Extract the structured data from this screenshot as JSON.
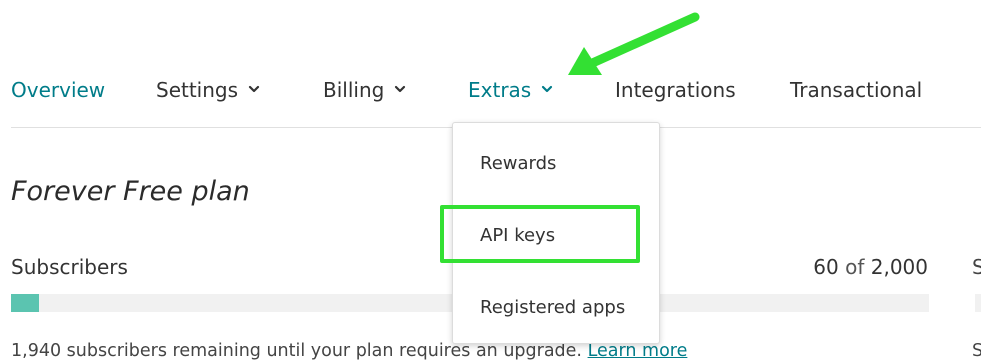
{
  "nav": {
    "items": [
      {
        "label": "Overview"
      },
      {
        "label": "Settings"
      },
      {
        "label": "Billing"
      },
      {
        "label": "Extras"
      },
      {
        "label": "Integrations"
      },
      {
        "label": "Transactional"
      }
    ]
  },
  "dropdown": {
    "items": [
      {
        "label": "Rewards"
      },
      {
        "label": "API keys"
      },
      {
        "label": "Registered apps"
      }
    ]
  },
  "plan": {
    "title": "Forever Free plan",
    "subscribers_label": "Subscribers",
    "used": "60",
    "of_word": "of",
    "limit": "2,000",
    "usage_fraction": 0.03,
    "remaining_text": "1,940 subscribers remaining until your plan requires an upgrade.",
    "learn_more": "Learn more"
  },
  "side": {
    "label_letter": "S",
    "text_letter": "S"
  },
  "colors": {
    "accent": "#007c89",
    "progress": "#5bc4b0",
    "annotation": "#33e033"
  },
  "icons": {
    "chevron": "chevron-down-icon",
    "annotation_arrow": "arrow-annotation-icon"
  }
}
